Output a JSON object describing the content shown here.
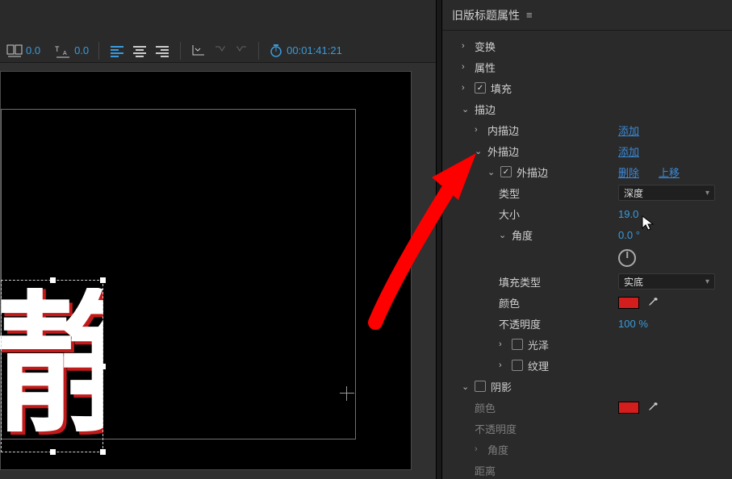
{
  "toolbar": {
    "tracking_va": "0.0",
    "tracking_ta": "0.0",
    "timecode": "00:01:41:21"
  },
  "panel": {
    "title": "旧版标题属性",
    "sections": {
      "transform": "变换",
      "attributes": "属性",
      "fill": "填充",
      "stroke": "描边",
      "inner_stroke": "内描边",
      "outer_stroke": "外描边",
      "outer_stroke_item": "外描边",
      "type": "类型",
      "size": "大小",
      "angle": "角度",
      "fill_type": "填充类型",
      "color": "颜色",
      "opacity": "不透明度",
      "sheen": "光泽",
      "texture": "纹理",
      "shadow": "阴影",
      "shadow_color": "颜色",
      "shadow_opacity": "不透明度",
      "shadow_angle": "角度",
      "shadow_distance": "距离"
    },
    "actions": {
      "add1": "添加",
      "add2": "添加",
      "delete": "删除",
      "move_up": "上移"
    },
    "values": {
      "type_select": "深度",
      "size": "19.0",
      "angle": "0.0",
      "fill_type_select": "实底",
      "opacity": "100"
    }
  }
}
